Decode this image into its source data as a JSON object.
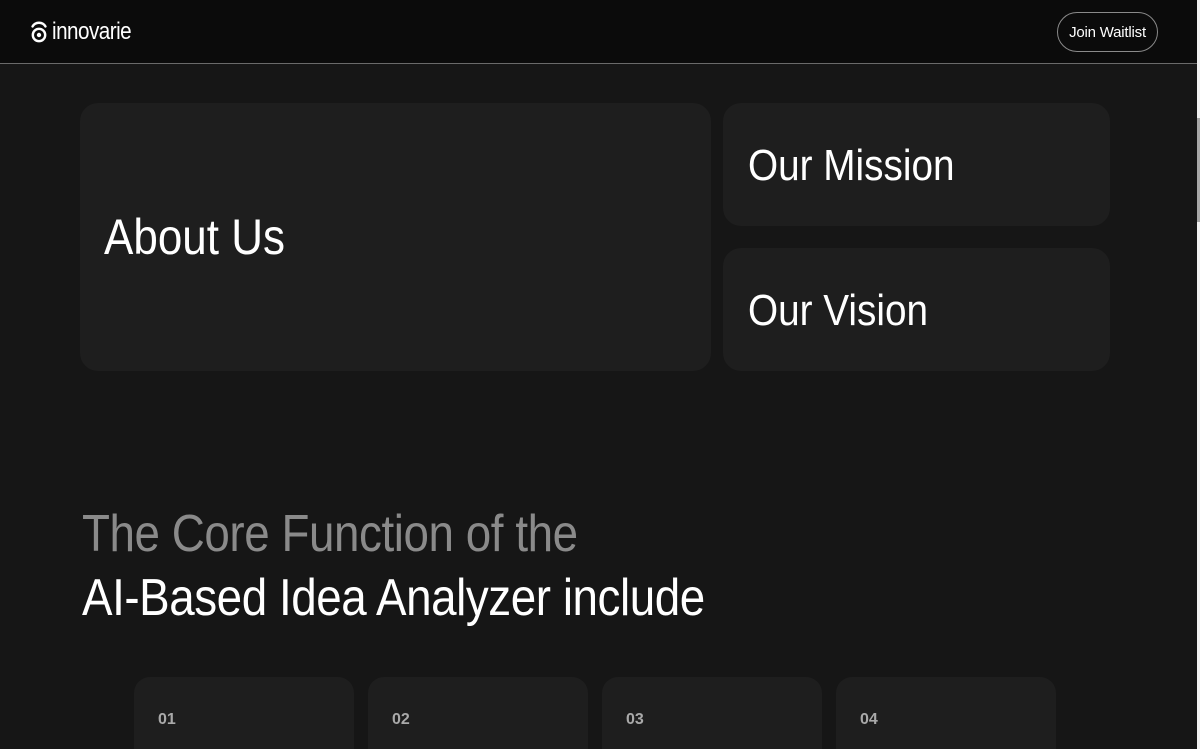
{
  "header": {
    "logo_text": "innovarie",
    "waitlist_label": "Join Waitlist"
  },
  "cards": {
    "about_title": "About Us",
    "mission_title": "Our Mission",
    "vision_title": "Our Vision"
  },
  "core": {
    "line1": "The Core Function of the",
    "line2": "AI-Based Idea Analyzer include"
  },
  "features": [
    {
      "number": "01"
    },
    {
      "number": "02"
    },
    {
      "number": "03"
    },
    {
      "number": "04"
    }
  ],
  "colors": {
    "background": "#161616",
    "header_background": "#0b0b0b",
    "card_background": "#1e1e1e",
    "muted_heading": "#8a8a8a",
    "text": "#ffffff"
  }
}
